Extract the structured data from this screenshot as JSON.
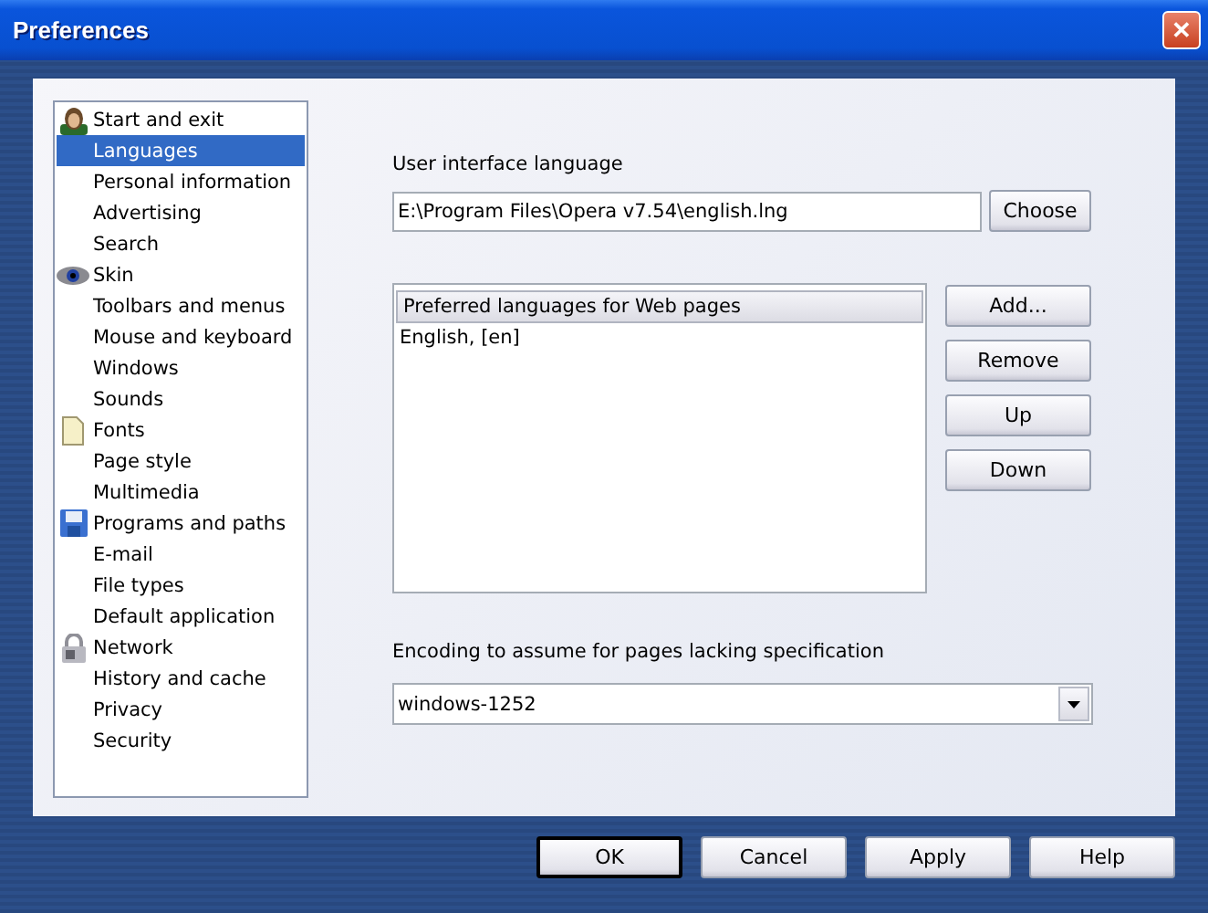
{
  "window": {
    "title": "Preferences",
    "close": "✕"
  },
  "sidebar": {
    "items": [
      {
        "label": "Start and exit",
        "kind": "person",
        "selected": false
      },
      {
        "label": "Languages",
        "kind": "plain",
        "selected": true
      },
      {
        "label": "Personal information",
        "kind": "plain",
        "selected": false
      },
      {
        "label": "Advertising",
        "kind": "plain",
        "selected": false
      },
      {
        "label": "Search",
        "kind": "plain",
        "selected": false
      },
      {
        "label": "Skin",
        "kind": "eye",
        "selected": false
      },
      {
        "label": "Toolbars and menus",
        "kind": "plain",
        "selected": false
      },
      {
        "label": "Mouse and keyboard",
        "kind": "plain",
        "selected": false
      },
      {
        "label": "Windows",
        "kind": "plain",
        "selected": false
      },
      {
        "label": "Sounds",
        "kind": "plain",
        "selected": false
      },
      {
        "label": "Fonts",
        "kind": "page",
        "selected": false
      },
      {
        "label": "Page style",
        "kind": "plain",
        "selected": false
      },
      {
        "label": "Multimedia",
        "kind": "plain",
        "selected": false
      },
      {
        "label": "Programs and paths",
        "kind": "disk",
        "selected": false
      },
      {
        "label": "E-mail",
        "kind": "plain",
        "selected": false
      },
      {
        "label": "File types",
        "kind": "plain",
        "selected": false
      },
      {
        "label": "Default application",
        "kind": "plain",
        "selected": false
      },
      {
        "label": "Network",
        "kind": "lock",
        "selected": false
      },
      {
        "label": "History and cache",
        "kind": "plain",
        "selected": false
      },
      {
        "label": "Privacy",
        "kind": "plain",
        "selected": false
      },
      {
        "label": "Security",
        "kind": "plain",
        "selected": false
      }
    ]
  },
  "ui_language": {
    "label": "User interface language",
    "value": "E:\\Program Files\\Opera v7.54\\english.lng",
    "button": "Choose"
  },
  "preferred_languages": {
    "header": "Preferred languages for Web pages",
    "rows": [
      "English, [en]"
    ],
    "buttons": [
      "Add...",
      "Remove",
      "Up",
      "Down"
    ]
  },
  "encoding": {
    "label": "Encoding to assume for pages lacking specification",
    "value": "windows-1252"
  },
  "buttons": [
    {
      "label": "OK",
      "default": true
    },
    {
      "label": "Cancel",
      "default": false
    },
    {
      "label": "Apply",
      "default": false
    },
    {
      "label": "Help",
      "default": false
    }
  ]
}
